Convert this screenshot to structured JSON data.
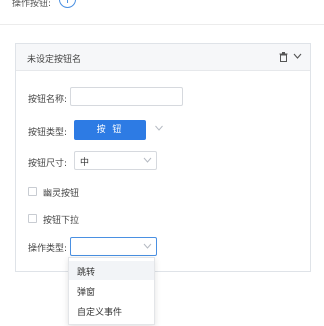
{
  "header": {
    "label": "操作按钮:",
    "add_symbol": "+"
  },
  "panel": {
    "title": "未设定按钮名",
    "fields": {
      "name_label": "按钮名称:",
      "name_value": "",
      "type_label": "按钮类型:",
      "type_button_text": "按 钮",
      "size_label": "按钮尺寸:",
      "size_value": "中",
      "ghost_label": "幽灵按钮",
      "dropdown_label": "按钮下拉",
      "action_label": "操作类型:",
      "action_value": ""
    }
  },
  "dropdown": {
    "options": [
      "跳转",
      "弹窗",
      "自定义事件"
    ]
  },
  "colors": {
    "accent": "#2d7be4",
    "border": "#d6d9de"
  }
}
